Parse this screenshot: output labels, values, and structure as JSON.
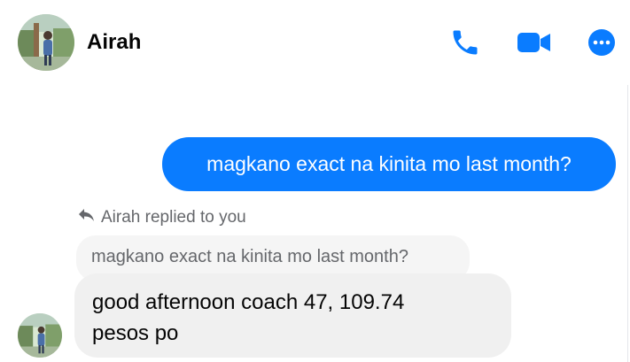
{
  "header": {
    "contact_name": "Airah",
    "icons": [
      "phone-icon",
      "video-camera-icon",
      "more-options-icon"
    ]
  },
  "conversation": {
    "outgoing_message": "magkano exact na kinita mo last month?",
    "reply_info": "Airah replied to you",
    "quoted_message": "magkano exact na kinita mo last month?",
    "incoming_message": "good afternoon coach 47, 109.74\npesos po"
  },
  "colors": {
    "accent": "#0a7cff",
    "incoming_bubble": "#f0f0f0",
    "quoted_bubble": "#f5f5f5",
    "secondary_text": "#65676b"
  }
}
